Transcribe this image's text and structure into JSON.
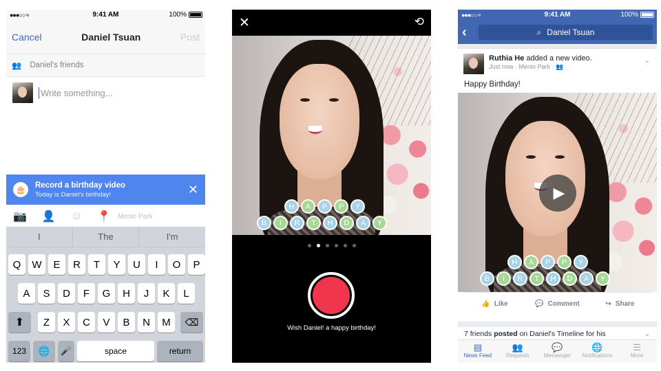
{
  "status": {
    "time": "9:41 AM",
    "battery": "100%"
  },
  "composer": {
    "cancel": "Cancel",
    "title": "Daniel Tsuan",
    "post": "Post",
    "audience": "Daniel's friends",
    "placeholder": "Write something...",
    "banner_title": "Record a birthday video",
    "banner_sub": "Today is Daniel's birthday!",
    "location": "Menlo Park",
    "suggestions": [
      "I",
      "The",
      "I'm"
    ],
    "keys_row1": [
      "Q",
      "W",
      "E",
      "R",
      "T",
      "Y",
      "U",
      "I",
      "O",
      "P"
    ],
    "keys_row2": [
      "A",
      "S",
      "D",
      "F",
      "G",
      "H",
      "J",
      "K",
      "L"
    ],
    "keys_row3": [
      "Z",
      "X",
      "C",
      "V",
      "B",
      "N",
      "M"
    ],
    "key_123": "123",
    "key_space": "space",
    "key_return": "return"
  },
  "camera": {
    "happy": [
      "H",
      "A",
      "P",
      "P",
      "Y"
    ],
    "birthday": [
      "B",
      "I",
      "R",
      "T",
      "H",
      "D",
      "A",
      "Y"
    ],
    "caption": "Wish Daniel! a happy birthday!"
  },
  "feed": {
    "search": "Daniel Tsuan",
    "author": "Ruthia He",
    "action": " added a new video.",
    "meta": "Just now · Menlo Park · ",
    "text": "Happy Birthday!",
    "like": "Like",
    "comment": "Comment",
    "share": "Share",
    "friends_count": "7 friends",
    "friends_posted": " posted",
    "friends_rest": " on Daniel's Timeline for his",
    "tabs": [
      "News Feed",
      "Requests",
      "Messenger",
      "Notifications",
      "More"
    ]
  },
  "colors": {
    "fb_blue": "#4267b2",
    "banner": "#4e86ee",
    "record": "#f0364d"
  }
}
